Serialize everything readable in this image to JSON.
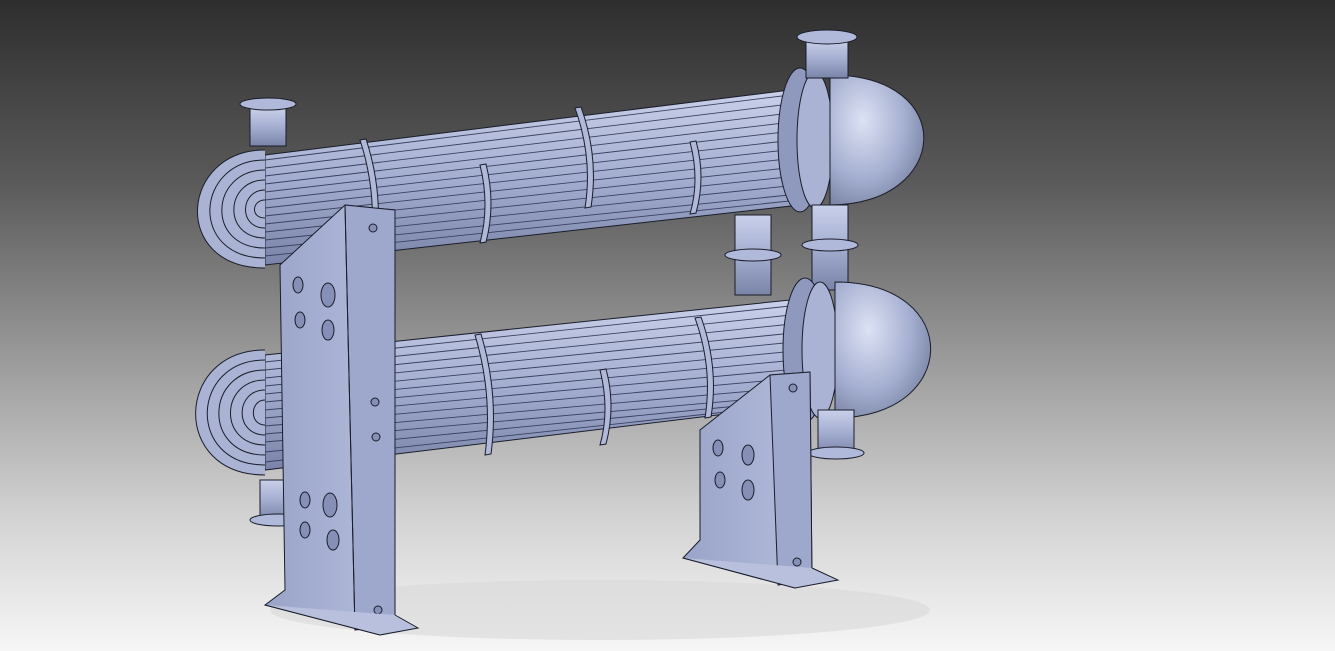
{
  "viewport": {
    "background_top": "#2e2e2e",
    "background_bottom": "#f6f6f6"
  },
  "model": {
    "part_color": "#a4aed0",
    "part_light": "#c9d0ea",
    "part_shadow": "#7a84a8",
    "edge_color": "#1a1d2a",
    "shell_count": 2,
    "support_count": 2,
    "baffles_per_shell": 4
  }
}
